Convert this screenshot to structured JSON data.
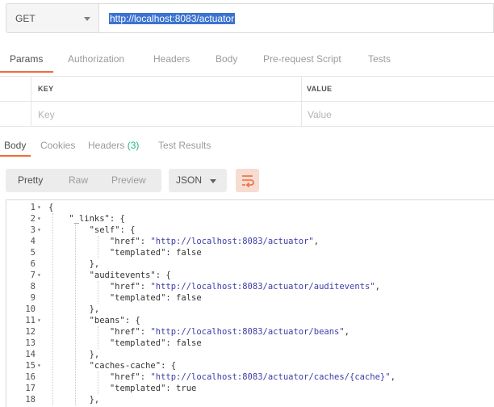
{
  "request": {
    "method": "GET",
    "url": "http://localhost:8083/actuator"
  },
  "request_tabs": [
    "Params",
    "Authorization",
    "Headers",
    "Body",
    "Pre-request Script",
    "Tests"
  ],
  "params": {
    "key_header": "KEY",
    "value_header": "VALUE",
    "key_placeholder": "Key",
    "value_placeholder": "Value"
  },
  "response_tabs": {
    "body": "Body",
    "cookies": "Cookies",
    "headers": "Headers",
    "headers_count": "(3)",
    "test_results": "Test Results"
  },
  "view": {
    "pretty": "Pretty",
    "raw": "Raw",
    "preview": "Preview",
    "format": "JSON"
  },
  "code_lines": [
    {
      "n": "1",
      "fold": true,
      "text": "{"
    },
    {
      "n": "2",
      "fold": true,
      "text": "    \"_links\": {"
    },
    {
      "n": "3",
      "fold": true,
      "text": "        \"self\": {"
    },
    {
      "n": "4",
      "fold": false,
      "text": "            \"href\": \"http://localhost:8083/actuator\","
    },
    {
      "n": "5",
      "fold": false,
      "text": "            \"templated\": false"
    },
    {
      "n": "6",
      "fold": false,
      "text": "        },"
    },
    {
      "n": "7",
      "fold": true,
      "text": "        \"auditevents\": {"
    },
    {
      "n": "8",
      "fold": false,
      "text": "            \"href\": \"http://localhost:8083/actuator/auditevents\","
    },
    {
      "n": "9",
      "fold": false,
      "text": "            \"templated\": false"
    },
    {
      "n": "10",
      "fold": false,
      "text": "        },"
    },
    {
      "n": "11",
      "fold": true,
      "text": "        \"beans\": {"
    },
    {
      "n": "12",
      "fold": false,
      "text": "            \"href\": \"http://localhost:8083/actuator/beans\","
    },
    {
      "n": "13",
      "fold": false,
      "text": "            \"templated\": false"
    },
    {
      "n": "14",
      "fold": false,
      "text": "        },"
    },
    {
      "n": "15",
      "fold": true,
      "text": "        \"caches-cache\": {"
    },
    {
      "n": "16",
      "fold": false,
      "text": "            \"href\": \"http://localhost:8083/actuator/caches/{cache}\","
    },
    {
      "n": "17",
      "fold": false,
      "text": "            \"templated\": true"
    },
    {
      "n": "18",
      "fold": false,
      "text": "        },"
    }
  ],
  "colors": {
    "accent_orange": "#f26b3a",
    "selection_blue": "#3b73d1",
    "count_green": "#26b47f",
    "string_blue": "#3d3da8"
  }
}
